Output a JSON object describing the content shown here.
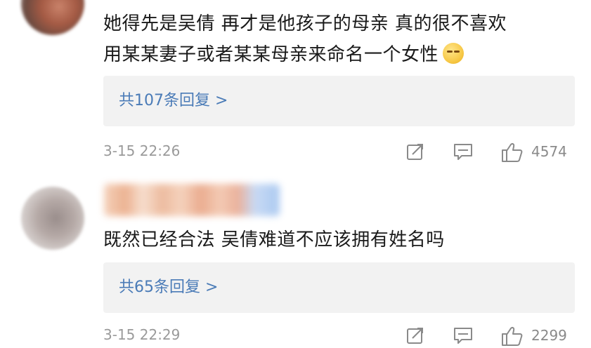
{
  "comments": [
    {
      "text_lines": [
        "她得先是吴倩 再才是他孩子的母亲 真的很不喜欢",
        "用某某妻子或者某某母亲来命名一个女性"
      ],
      "emoji": "smirk-emoji",
      "replies_label": "共107条回复 >",
      "timestamp": "3-15 22:26",
      "like_count": "4574"
    },
    {
      "text_lines": [
        "既然已经合法  吴倩难道不应该拥有姓名吗"
      ],
      "replies_label": "共65条回复 >",
      "timestamp": "3-15 22:29",
      "like_count": "2299"
    }
  ],
  "icons": {
    "forward": "forward-icon",
    "comment": "comment-icon",
    "like": "thumbs-up-icon"
  },
  "colors": {
    "reply_link": "#4a7bb7",
    "reply_bg": "#f2f2f2",
    "meta_text": "#9a9a9a"
  }
}
